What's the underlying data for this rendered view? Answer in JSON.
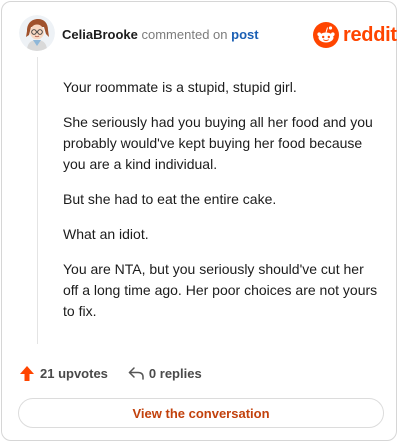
{
  "comment": {
    "username": "CeliaBrooke",
    "action_text": "commented on",
    "post_link": "post",
    "paragraphs": [
      "Your roommate is a stupid, stupid girl.",
      "She seriously had you buying all her food and you probably would've kept buying her food because you are a kind individual.",
      "But she had to eat the entire cake.",
      "What an idiot.",
      "You are NTA, but you seriously should've cut her off a long time ago. Her poor choices are not yours to fix."
    ]
  },
  "brand": {
    "name": "reddit",
    "icon": "reddit-alien-icon",
    "color": "#ff4500"
  },
  "stats": {
    "upvotes_label": "21 upvotes",
    "upvote_icon": "upvote-arrow-icon",
    "upvote_color": "#ff4500",
    "replies_label": "0 replies",
    "reply_icon": "reply-arrow-icon"
  },
  "cta": {
    "label": "View the conversation"
  }
}
